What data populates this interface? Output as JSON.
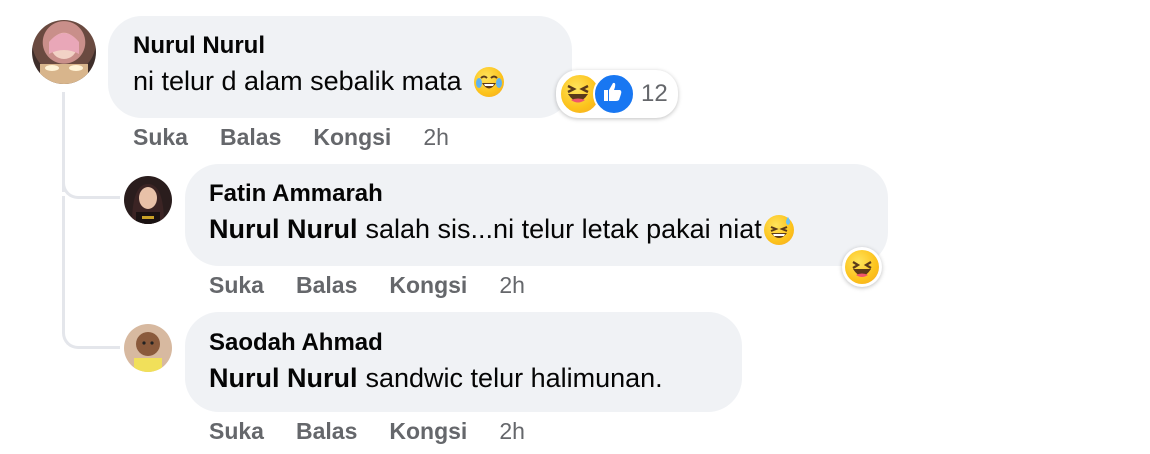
{
  "comments": [
    {
      "author": "Nurul Nurul",
      "text": "ni telur d alam sebalik mata",
      "emoji": "face-with-tears-of-joy-icon",
      "reactions": {
        "types": [
          "haha",
          "like"
        ],
        "count": "12"
      },
      "actions": {
        "like": "Suka",
        "reply": "Balas",
        "share": "Kongsi",
        "time": "2h"
      }
    },
    {
      "author": "Fatin Ammarah",
      "mention": "Nurul Nurul",
      "text": "salah sis...ni telur letak pakai niat",
      "emoji": "grinning-squinting-face-icon",
      "reactions": {
        "types": [
          "haha"
        ]
      },
      "actions": {
        "like": "Suka",
        "reply": "Balas",
        "share": "Kongsi",
        "time": "2h"
      }
    },
    {
      "author": "Saodah Ahmad",
      "mention": "Nurul Nurul",
      "text": "sandwic telur halimunan.",
      "actions": {
        "like": "Suka",
        "reply": "Balas",
        "share": "Kongsi",
        "time": "2h"
      }
    }
  ],
  "colors": {
    "bubble": "#f0f2f5",
    "secondary_text": "#65676b",
    "like_blue": "#1877f2",
    "thread_line": "#e4e6eb"
  }
}
